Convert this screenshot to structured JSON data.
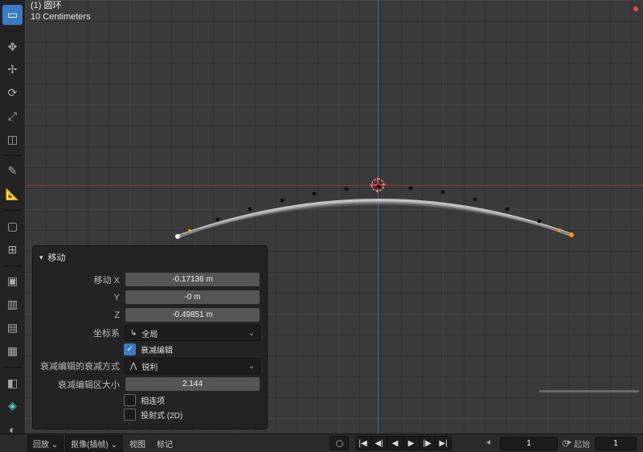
{
  "top_info": {
    "line1": "(1) 圆环",
    "line2": "10 Centimeters"
  },
  "panel": {
    "title": "移动",
    "move_x_label": "移动 X",
    "move_y_label": "Y",
    "move_z_label": "Z",
    "move_x": "-0.17136 m",
    "move_y": "-0 m",
    "move_z": "-0.49851 m",
    "orientation_label": "坐标系",
    "orientation_value": "全局",
    "prop_edit_label": "衰减编辑",
    "prop_edit_checked": true,
    "falloff_label": "衰减编辑的衰减方式",
    "falloff_value": "锐利",
    "prop_size_label": "衰减编辑区大小",
    "prop_size": "2.144",
    "connected_label": "相连项",
    "connected_checked": false,
    "projected_label": "投射式 (2D)",
    "projected_checked": false
  },
  "bottom": {
    "playback": "回放",
    "keying": "抠像(插帧)",
    "view": "视图",
    "marker": "标记",
    "current_frame": "1",
    "start_label": "起始",
    "start": "1"
  }
}
